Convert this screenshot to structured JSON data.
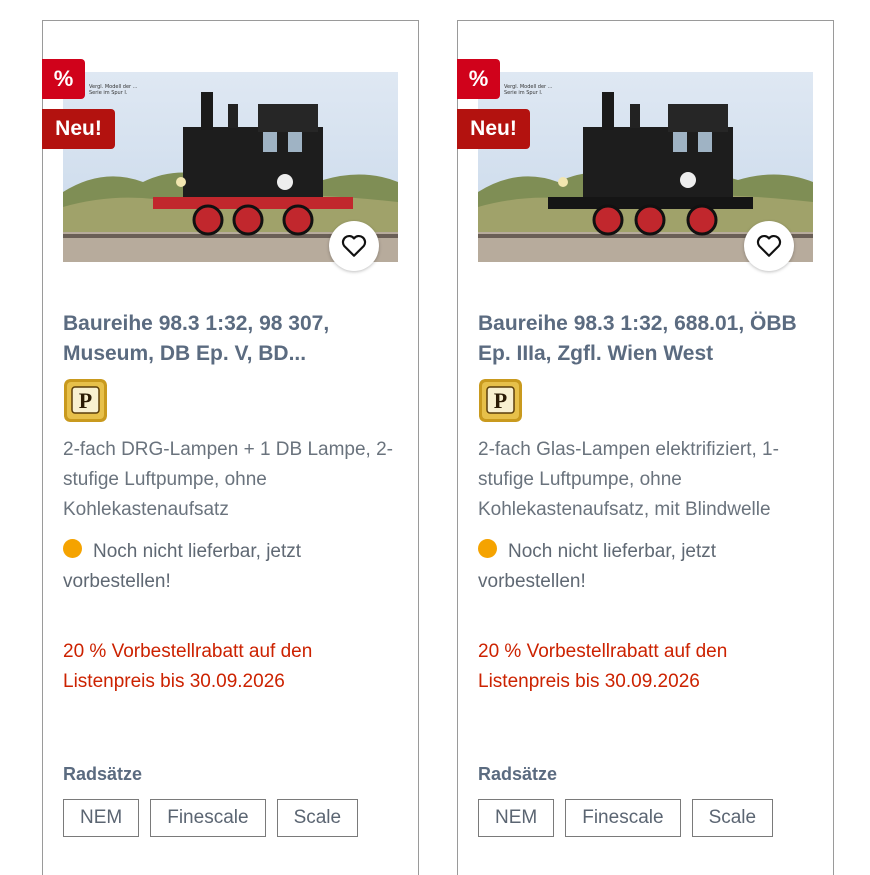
{
  "products": [
    {
      "badge_discount": "%",
      "badge_new": "Neu!",
      "photo_caption": "Vergl. Modell der ... Serie im Spur I.",
      "title": "Baureihe 98.3 1:32, 98 307, Museum, DB Ep. V, BD...",
      "premium_icon": "premium-p-icon",
      "description": "2-fach DRG-Lampen + 1 DB Lampe, 2-stufige Luftpumpe, ohne Kohlekastenaufsatz",
      "availability": "Noch nicht lieferbar, jetzt vorbestellen!",
      "availability_color": "#f5a300",
      "promo": "20 % Vorbestellrabatt auf den Listenpreis bis 30.09.2026",
      "wheels_label": "Radsätze",
      "wheel_options": [
        "NEM",
        "Finescale",
        "Scale"
      ]
    },
    {
      "badge_discount": "%",
      "badge_new": "Neu!",
      "photo_caption": "Vergl. Modell der ... Serie im Spur I.",
      "title": "Baureihe 98.3 1:32, 688.01, ÖBB Ep. IIIa, Zgfl. Wien West",
      "premium_icon": "premium-p-icon",
      "description": "2-fach Glas-Lampen elektrifiziert, 1-stufige Luftpumpe, ohne Kohlekastenaufsatz, mit Blindwelle",
      "availability": "Noch nicht lieferbar, jetzt vorbestellen!",
      "availability_color": "#f5a300",
      "promo": "20 % Vorbestellrabatt auf den Listenpreis bis 30.09.2026",
      "wheels_label": "Radsätze",
      "wheel_options": [
        "NEM",
        "Finescale",
        "Scale"
      ]
    }
  ],
  "colors": {
    "badge_discount": "#d0021b",
    "badge_new": "#b3120f",
    "promo_text": "#cc2200",
    "title_text": "#5b6b80"
  }
}
